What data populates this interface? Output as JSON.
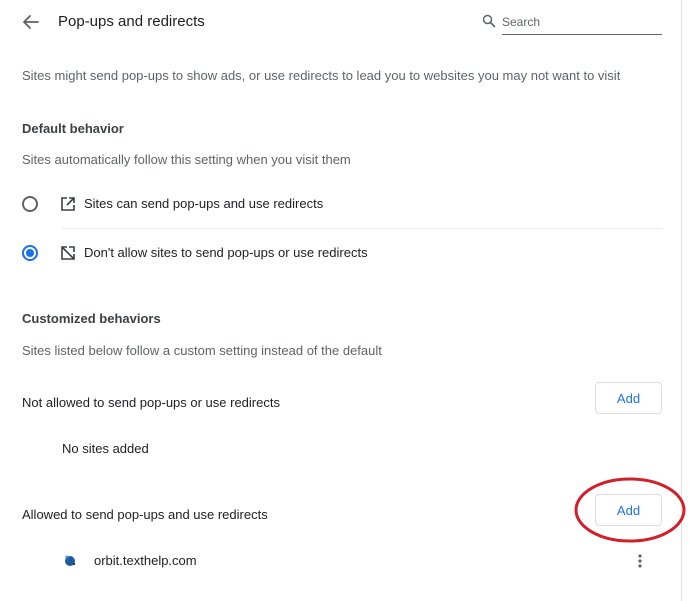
{
  "header": {
    "title": "Pop-ups and redirects",
    "search_placeholder": "Search"
  },
  "intro": "Sites might send pop-ups to show ads, or use redirects to lead you to websites you may not want to visit",
  "default_behavior": {
    "heading": "Default behavior",
    "description": "Sites automatically follow this setting when you visit them",
    "options": [
      {
        "label": "Sites can send pop-ups and use redirects",
        "icon": "open-in-new-icon",
        "selected": false
      },
      {
        "label": "Don't allow sites to send pop-ups or use redirects",
        "icon": "popup-blocked-icon",
        "selected": true
      }
    ]
  },
  "customized": {
    "heading": "Customized behaviors",
    "description": "Sites listed below follow a custom setting instead of the default",
    "blocked": {
      "label": "Not allowed to send pop-ups or use redirects",
      "add_label": "Add",
      "empty_text": "No sites added"
    },
    "allowed": {
      "label": "Allowed to send pop-ups and use redirects",
      "add_label": "Add",
      "sites": [
        {
          "domain": "orbit.texthelp.com",
          "icon": "site-favicon"
        }
      ]
    }
  },
  "colors": {
    "accent": "#1a73e8",
    "annotation": "#d21f2a",
    "text_primary": "#202124",
    "text_secondary": "#5f6368"
  }
}
